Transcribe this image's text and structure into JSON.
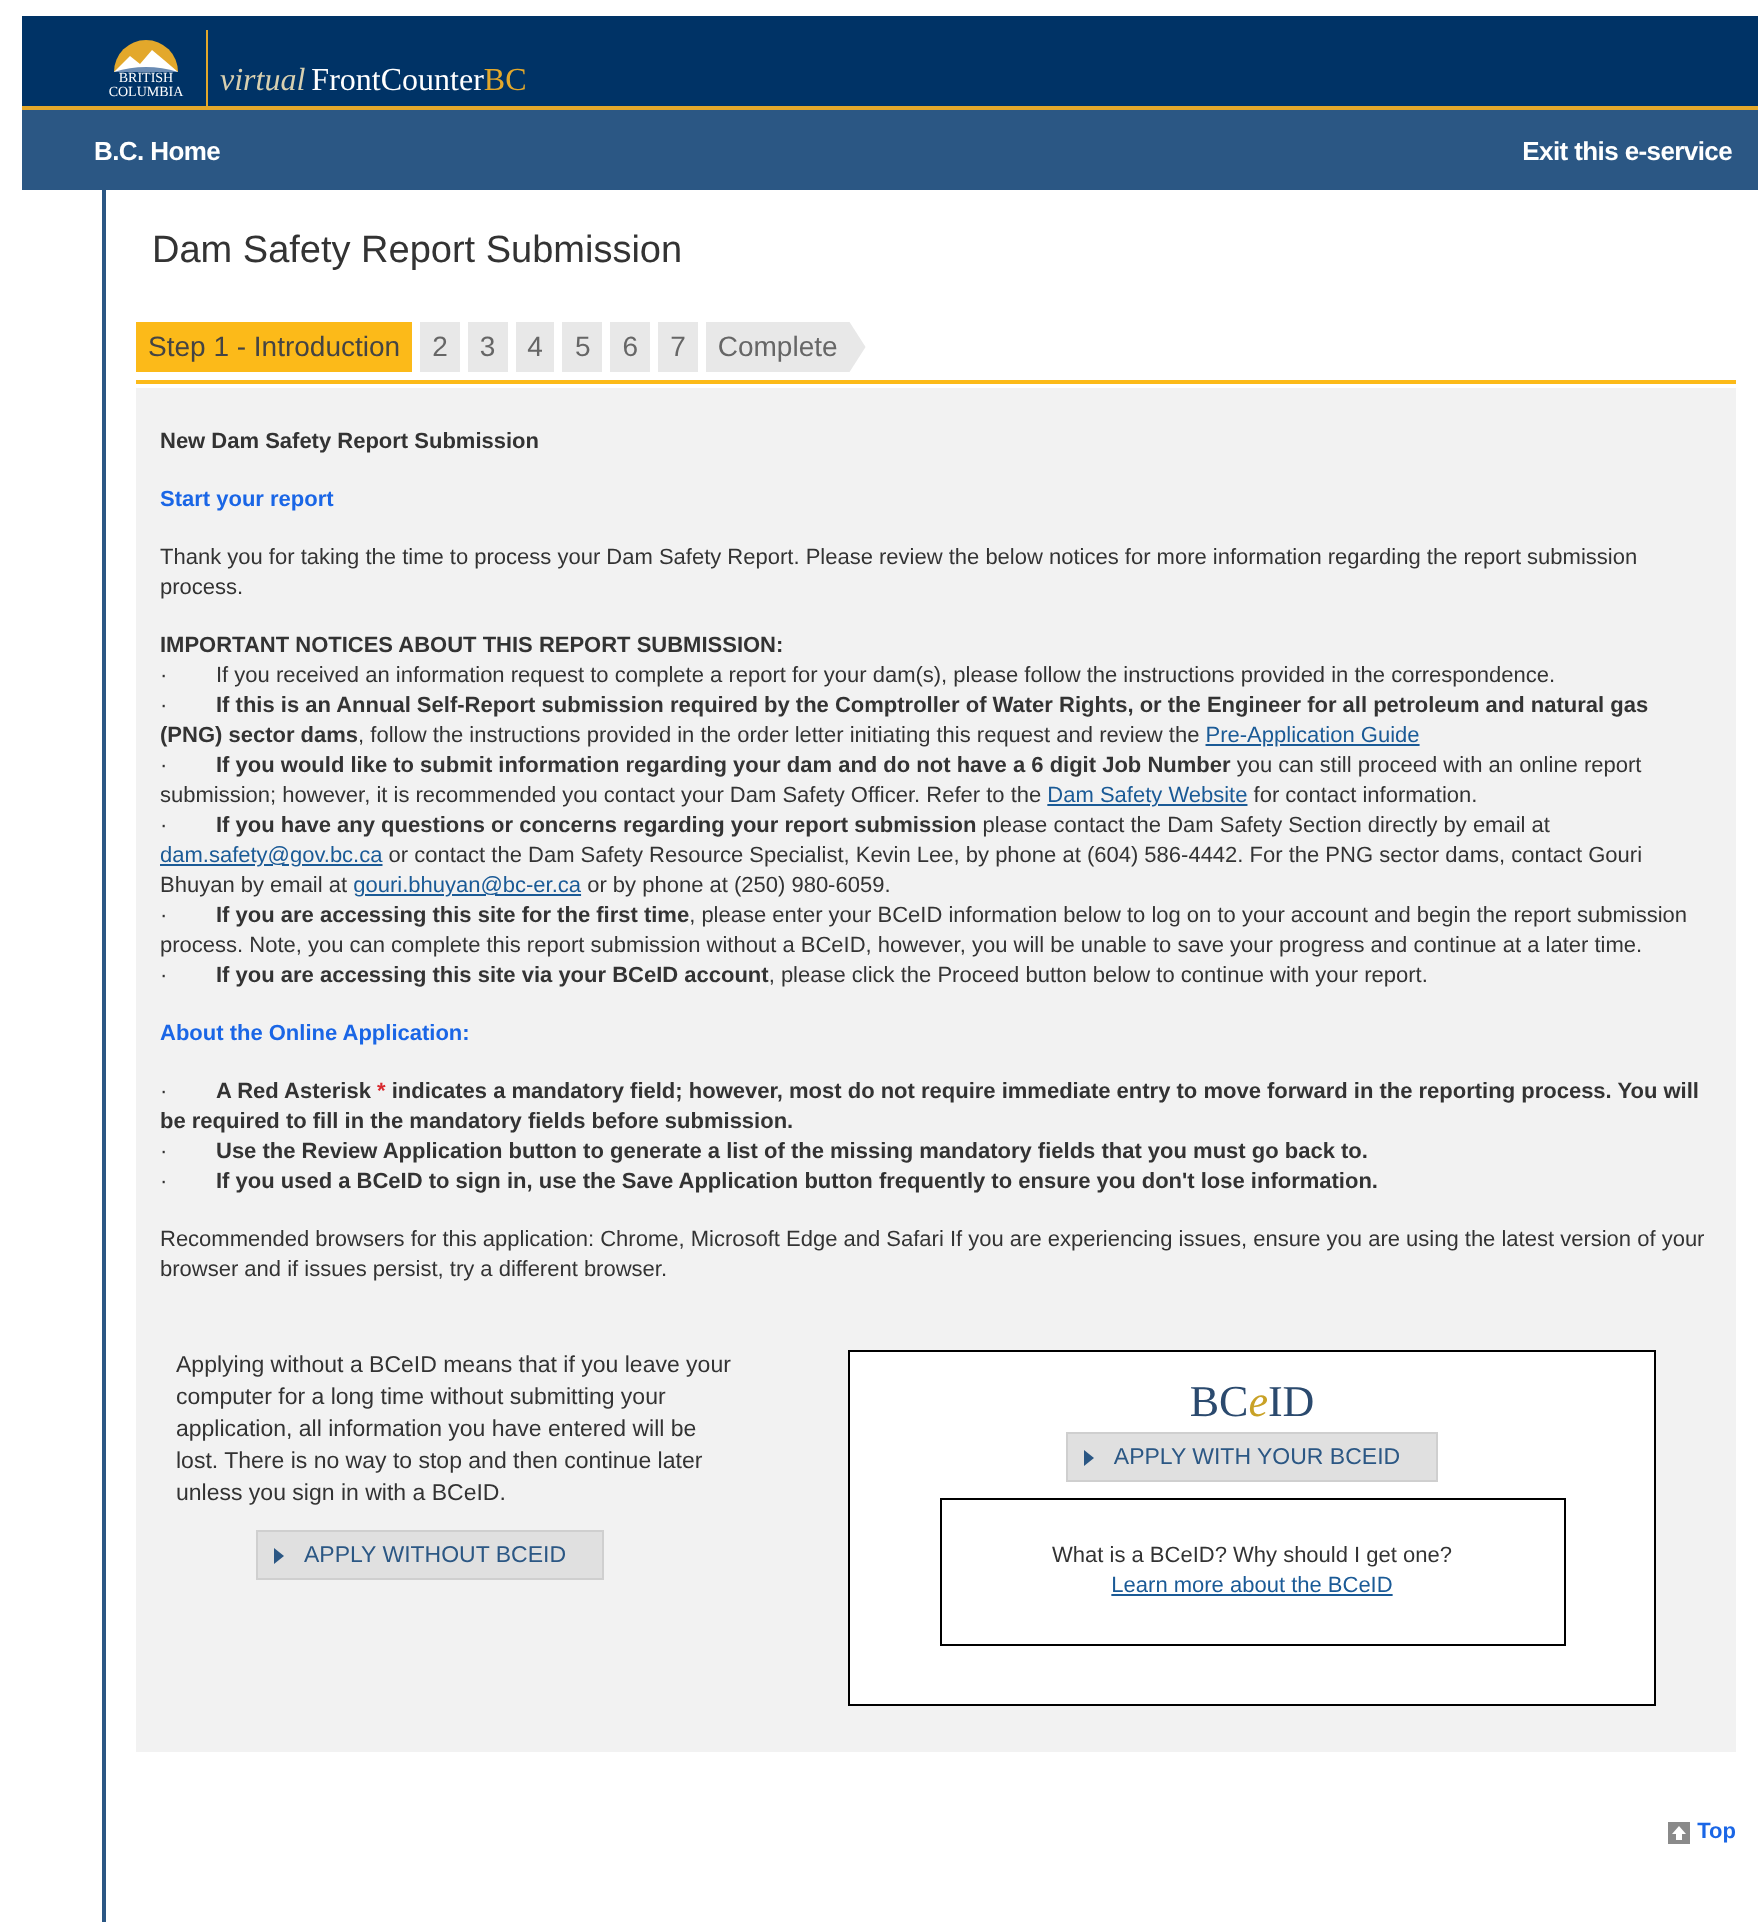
{
  "header": {
    "logo_lines": [
      "BRITISH",
      "COLUMBIA"
    ],
    "service": {
      "prefix": "virtual",
      "name": "FrontCounter",
      "suffix": "BC"
    }
  },
  "nav": {
    "left": "B.C. Home",
    "right": "Exit this e-service"
  },
  "page_title": "Dam Safety Report Submission",
  "steps": [
    {
      "label": "Step 1 - Introduction",
      "selected": true,
      "kind": "step"
    },
    {
      "label": "2",
      "selected": false,
      "kind": "step"
    },
    {
      "label": "3",
      "selected": false,
      "kind": "step"
    },
    {
      "label": "4",
      "selected": false,
      "kind": "step"
    },
    {
      "label": "5",
      "selected": false,
      "kind": "step"
    },
    {
      "label": "6",
      "selected": false,
      "kind": "step"
    },
    {
      "label": "7",
      "selected": false,
      "kind": "step"
    },
    {
      "label": "Complete",
      "selected": false,
      "kind": "final"
    }
  ],
  "form_title": "New Dam Safety Report Submission",
  "start_heading": "Start your report",
  "intro": "Thank you for taking the time to process your Dam Safety Report.  Please review the below notices for more information regarding the report submission process.",
  "notices_heading": "IMPORTANT NOTICES ABOUT THIS REPORT SUBMISSION:",
  "notices": [
    {
      "bullet": "·",
      "segments": [
        {
          "kind": "plain",
          "text": "If you received an information request to complete a report for your dam(s), please follow the instructions provided in the correspondence."
        }
      ]
    },
    {
      "bullet": "·",
      "segments": [
        {
          "kind": "bold",
          "text": "If this is an Annual Self-Report submission required by the Comptroller of Water Rights, or the Engineer for all petroleum and natural gas (PNG) sector dams"
        },
        {
          "kind": "plain",
          "text": ", follow the instructions provided in the order letter initiating this request and review the  "
        },
        {
          "kind": "link",
          "text": "Pre-Application Guide"
        }
      ]
    },
    {
      "bullet": "·",
      "segments": [
        {
          "kind": "bold",
          "text": "If you would like to submit information regarding your dam and do not have a 6 digit Job Number"
        },
        {
          "kind": "plain",
          "text": " you can still proceed with an online report submission; however, it is recommended you contact your Dam Safety Officer. Refer to the "
        },
        {
          "kind": "link",
          "text": "Dam Safety Website"
        },
        {
          "kind": "plain",
          "text": " for contact information."
        }
      ]
    },
    {
      "bullet": "·",
      "segments": [
        {
          "kind": "bold",
          "text": "If you have any questions or concerns regarding your report submission"
        },
        {
          "kind": "plain",
          "text": " please contact the Dam Safety Section directly by email at "
        },
        {
          "kind": "link",
          "text": "dam.safety@gov.bc.ca"
        },
        {
          "kind": "plain",
          "text": "  or contact the Dam Safety Resource Specialist, Kevin Lee, by phone at (604) 586-4442. For the PNG sector dams, contact Gouri Bhuyan by email at "
        },
        {
          "kind": "link",
          "text": "gouri.bhuyan@bc-er.ca"
        },
        {
          "kind": "plain",
          "text": " or by phone at (250) 980-6059."
        }
      ]
    },
    {
      "bullet": "·",
      "segments": [
        {
          "kind": "bold",
          "text": "If you are accessing this site for the first time"
        },
        {
          "kind": "plain",
          "text": ", please enter your BCeID information below to log on to your account and begin the report submission process.  Note, you can complete this report submission without a BCeID, however, you will be unable to save your progress and continue at a later time."
        }
      ]
    },
    {
      "bullet": "·",
      "segments": [
        {
          "kind": "bold",
          "text": "If you are accessing this site via your BCeID account"
        },
        {
          "kind": "plain",
          "text": ", please click the Proceed button below to continue with your report."
        }
      ]
    }
  ],
  "about_heading": "About the Online Application:",
  "about": [
    {
      "bullet": "·",
      "segments": [
        {
          "kind": "bold",
          "text": "A Red Asterisk "
        },
        {
          "kind": "required",
          "text": "*"
        },
        {
          "kind": "bold",
          "text": " indicates a mandatory field; however, most do not require immediate entry to move forward in the reporting process. You will be required to fill in the mandatory fields before submission."
        }
      ]
    },
    {
      "bullet": "·",
      "segments": [
        {
          "kind": "bold",
          "text": "Use the Review Application button to generate a list of the missing mandatory fields that you must go back to."
        }
      ]
    },
    {
      "bullet": "·",
      "segments": [
        {
          "kind": "bold",
          "text": "If you used a BCeID to sign in, use the Save Application button frequently to ensure you don't lose information."
        }
      ]
    }
  ],
  "browsers": "Recommended browsers for this application: Chrome, Microsoft Edge and Safari If you are experiencing issues, ensure you are using the latest version of your browser and if issues persist, try a different browser.",
  "without_text": "Applying without a BCeID means that if you leave your computer for a long time without submitting your application, all information you have entered will be lost. There is no way to stop and then continue later unless you sign in with a BCeID.",
  "without_button": "APPLY WITHOUT BCEID",
  "bceid_logo": {
    "lead": "BC",
    "accent": "e",
    "tail": "ID"
  },
  "with_button": "APPLY WITH YOUR BCEID",
  "info_question": "What is a BCeID? Why should I get one?",
  "info_link": "Learn more about the BCeID",
  "top_link": "Top"
}
